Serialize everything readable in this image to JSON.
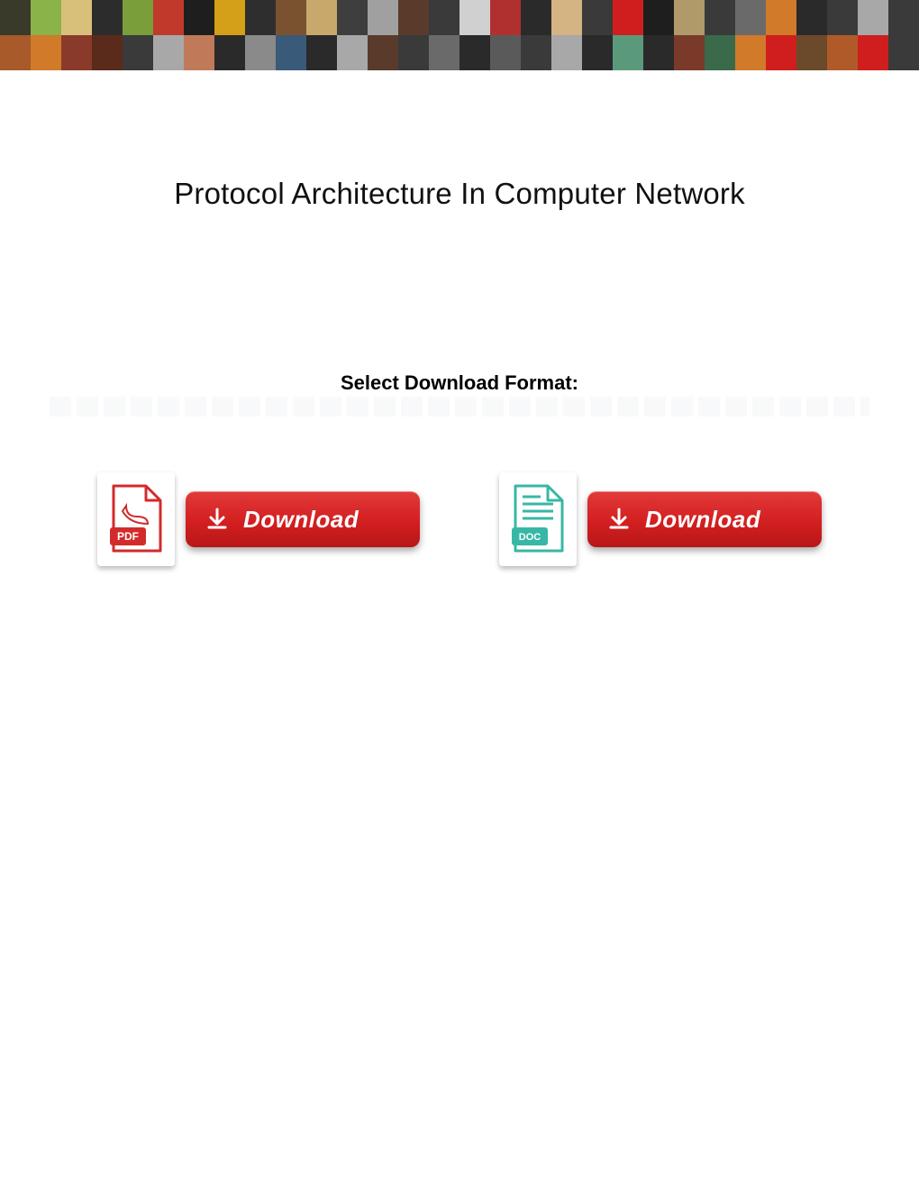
{
  "header": {
    "tiles": [
      "#3a3a2a",
      "#8ab34a",
      "#d9c07a",
      "#2c2c2c",
      "#7a9e3a",
      "#c0392b",
      "#1e1e1e",
      "#d4a017",
      "#2e2e2e",
      "#7a5230",
      "#c9a96b",
      "#3e3e3e",
      "#a0a0a0",
      "#5a3a2a",
      "#3a3a3a",
      "#d0d0d0",
      "#b03030",
      "#2a2a2a",
      "#d4b483",
      "#3a3a3a",
      "#d01e1e",
      "#1e1e1e",
      "#b09a6a",
      "#3a3a3a",
      "#6a6a6a",
      "#d07a2a",
      "#2a2a2a",
      "#3a3a3a",
      "#a8a8a8",
      "#3a3a3a",
      "#a85a2a",
      "#d07a2a",
      "#8a3a2a",
      "#5a2a1a",
      "#3a3a3a",
      "#a8a8a8",
      "#c07a5a",
      "#2a2a2a",
      "#8a8a8a",
      "#3a5a7a",
      "#2a2a2a",
      "#a8a8a8",
      "#5a3a2a",
      "#3a3a3a",
      "#6a6a6a",
      "#2a2a2a",
      "#5a5a5a",
      "#3a3a3a",
      "#a8a8a8",
      "#2a2a2a",
      "#5a9a7a",
      "#2a2a2a",
      "#7a3a2a",
      "#3a6a4a",
      "#d07a2a",
      "#d01e1e",
      "#6a4a2a",
      "#b05a2a",
      "#d01e1e",
      "#3a3a3a"
    ]
  },
  "title": "Protocol Architecture In Computer Network",
  "format_label": "Select Download Format:",
  "downloads": {
    "pdf": {
      "badge": "PDF",
      "button": "Download",
      "color": "#d32b2b"
    },
    "doc": {
      "badge": "DOC",
      "button": "Download",
      "color": "#38b7a6"
    }
  }
}
